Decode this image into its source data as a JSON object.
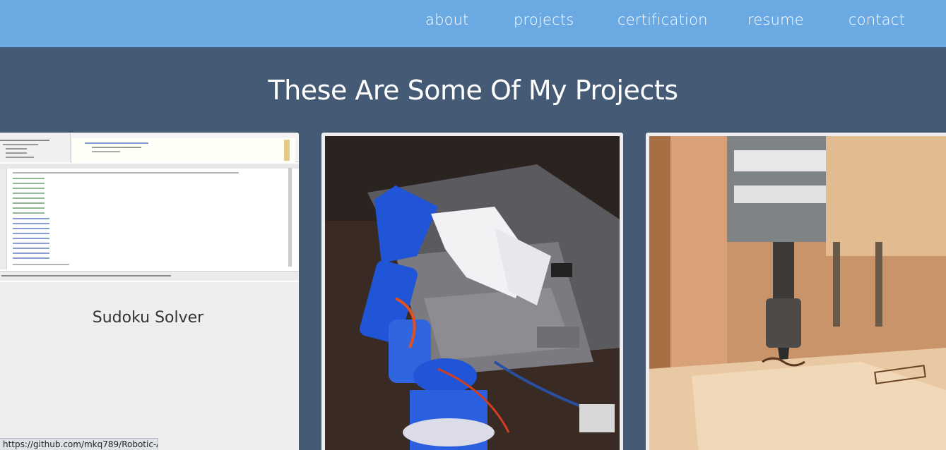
{
  "nav": {
    "items": [
      {
        "label": "about"
      },
      {
        "label": "projects"
      },
      {
        "label": "certification"
      },
      {
        "label": "resume"
      },
      {
        "label": "contact"
      }
    ]
  },
  "main": {
    "heading": "These Are Some Of My Projects",
    "projects": [
      {
        "title": "Sudoku Solver"
      },
      {
        "title": ""
      },
      {
        "title": ""
      }
    ]
  },
  "status": {
    "link_url": "https://github.com/mkq789/Robotic-Arm"
  },
  "colors": {
    "navbar": "#6aa9e2",
    "page_background": "#455a74",
    "card_background": "#eeeeee"
  }
}
